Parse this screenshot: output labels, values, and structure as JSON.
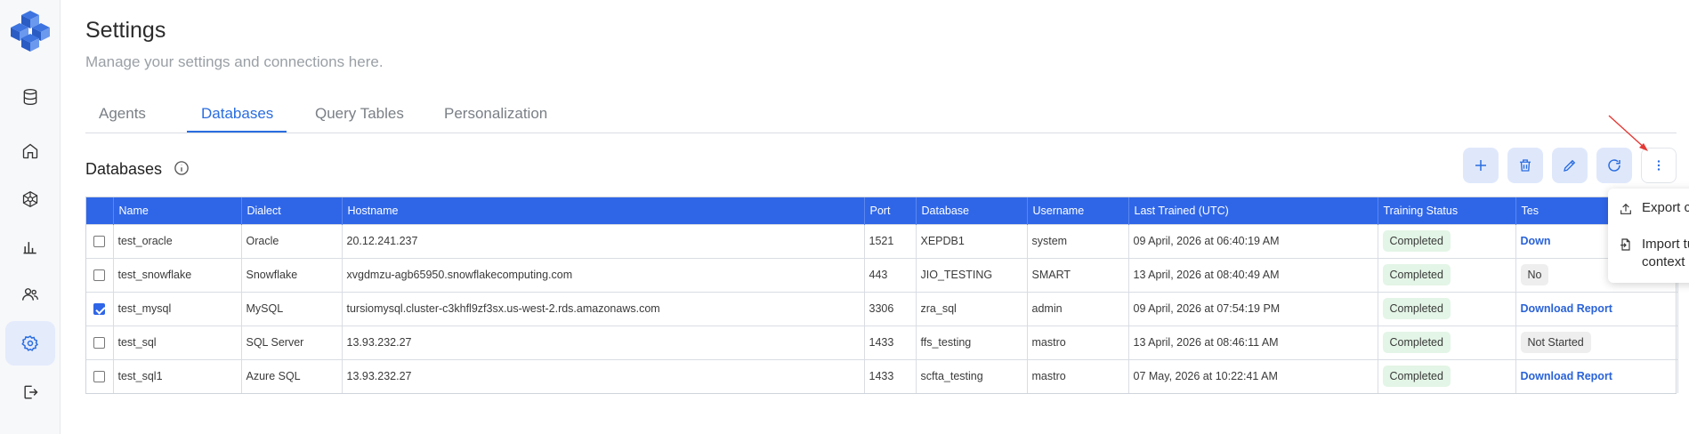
{
  "header": {
    "title": "Settings",
    "subtitle": "Manage your settings and connections here."
  },
  "tabs": [
    {
      "label": "Agents",
      "active": false
    },
    {
      "label": "Databases",
      "active": true
    },
    {
      "label": "Query Tables",
      "active": false
    },
    {
      "label": "Personalization",
      "active": false
    }
  ],
  "section": {
    "title": "Databases"
  },
  "table": {
    "columns": [
      "Name",
      "Dialect",
      "Hostname",
      "Port",
      "Database",
      "Username",
      "Last Trained (UTC)",
      "Training Status",
      "Tes"
    ],
    "rows": [
      {
        "checked": false,
        "name": "test_oracle",
        "dialect": "Oracle",
        "hostname": "20.12.241.237",
        "port": "1521",
        "database": "XEPDB1",
        "username": "system",
        "last_trained": "09 April, 2026 at 06:40:19 AM",
        "training_status": "Completed",
        "test": "Down"
      },
      {
        "checked": false,
        "name": "test_snowflake",
        "dialect": "Snowflake",
        "hostname": "xvgdmzu-agb65950.snowflakecomputing.com",
        "port": "443",
        "database": "JIO_TESTING",
        "username": "SMART",
        "last_trained": "13 April, 2026 at 08:40:49 AM",
        "training_status": "Completed",
        "test": "No"
      },
      {
        "checked": true,
        "name": "test_mysql",
        "dialect": "MySQL",
        "hostname": "tursiomysql.cluster-c3khfl9zf3sx.us-west-2.rds.amazonaws.com",
        "port": "3306",
        "database": "zra_sql",
        "username": "admin",
        "last_trained": "09 April, 2026 at 07:54:19 PM",
        "training_status": "Completed",
        "test": "Download Report"
      },
      {
        "checked": false,
        "name": "test_sql",
        "dialect": "SQL Server",
        "hostname": "13.93.232.27",
        "port": "1433",
        "database": "ffs_testing",
        "username": "mastro",
        "last_trained": "13 April, 2026 at 08:46:11 AM",
        "training_status": "Completed",
        "test": "Not Started"
      },
      {
        "checked": false,
        "name": "test_sql1",
        "dialect": "Azure SQL",
        "hostname": "13.93.232.27",
        "port": "1433",
        "database": "scfta_testing",
        "username": "mastro",
        "last_trained": "07 May, 2026 at 10:22:41 AM",
        "training_status": "Completed",
        "test": "Download Report"
      }
    ]
  },
  "dropdown": {
    "export_label": "Export context",
    "import_label": "Import tuned context"
  },
  "colors": {
    "accent": "#2f66e8",
    "completed_bg": "#e3f5e6",
    "annotation_arrow": "#e53935"
  }
}
